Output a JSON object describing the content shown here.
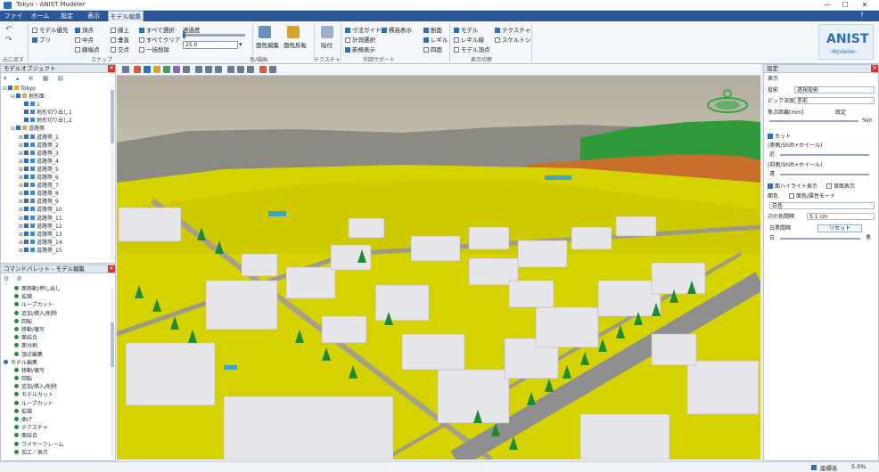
{
  "window": {
    "title": "Tokyo - ANIST Modeler",
    "controls": {
      "minimize": "—",
      "maximize": "☐",
      "close": "✕"
    },
    "help": "?"
  },
  "tabs": [
    {
      "label": "ファイル"
    },
    {
      "label": "ホーム"
    },
    {
      "label": "設定"
    },
    {
      "label": "表示"
    },
    {
      "label": "モデル編集",
      "active": true
    }
  ],
  "ribbon": {
    "undo_group": {
      "label": "元に戻す"
    },
    "snap_group": {
      "label": "スナップ",
      "items": [
        {
          "label": "モデル優先",
          "checked": false
        },
        {
          "label": "ブリ",
          "checked": true
        },
        {
          "label": "頂点",
          "checked": true
        },
        {
          "label": "中点",
          "checked": false
        },
        {
          "label": "線端点",
          "checked": false
        },
        {
          "label": "線上",
          "checked": false
        },
        {
          "label": "垂直",
          "checked": false
        },
        {
          "label": "交点",
          "checked": false
        }
      ]
    },
    "select_group": {
      "items": [
        {
          "label": "すべて選択",
          "checked": true
        },
        {
          "label": "すべてクリア",
          "checked": false
        },
        {
          "label": "一括削除",
          "checked": false
        }
      ]
    },
    "transparency": {
      "label": "透過度",
      "value": "25.0"
    },
    "color_group": {
      "label": "色/描画",
      "buttons": [
        {
          "label": "面色編集"
        },
        {
          "label": "面色反転"
        }
      ]
    },
    "texture_group": {
      "label": "テクスチャ",
      "button": "貼付"
    },
    "work_support_group": {
      "label": "作図サポート",
      "items": [
        {
          "label": "寸法ガイド",
          "checked": true
        },
        {
          "label": "標高表示",
          "checked": true
        },
        {
          "label": "計測選択",
          "checked": false
        },
        {
          "label": "断面",
          "checked": true
        },
        {
          "label": "新規表示",
          "checked": true
        },
        {
          "label": "レギル",
          "checked": true
        },
        {
          "label": "四面",
          "checked": false
        }
      ]
    },
    "display_group": {
      "label": "表示切替",
      "items": [
        {
          "label": "モデル",
          "checked": true
        },
        {
          "label": "テクスチャ",
          "checked": true
        },
        {
          "label": "レギル線",
          "checked": false
        },
        {
          "label": "スケルトン",
          "checked": false
        },
        {
          "label": "モデル頂点",
          "checked": false
        }
      ]
    },
    "logo": {
      "text": "ANIST",
      "subtext": "-Modeler-"
    }
  },
  "model_panel": {
    "title": "モデルオブジェクト",
    "tree": [
      {
        "indent": 0,
        "expander": "⊟",
        "kind": "folder",
        "label": "Tokyo"
      },
      {
        "indent": 1,
        "expander": "⊟",
        "kind": "folder",
        "label": "地形面"
      },
      {
        "indent": 2,
        "expander": "",
        "kind": "item",
        "label": "1"
      },
      {
        "indent": 2,
        "expander": "",
        "kind": "item",
        "label": "地形切り出し1"
      },
      {
        "indent": 2,
        "expander": "",
        "kind": "item",
        "label": "地形切り出し2"
      },
      {
        "indent": 1,
        "expander": "⊟",
        "kind": "folder",
        "label": "道路等"
      },
      {
        "indent": 2,
        "expander": "⊞",
        "kind": "item",
        "label": "道路等_1"
      },
      {
        "indent": 2,
        "expander": "⊞",
        "kind": "item",
        "label": "道路等_2"
      },
      {
        "indent": 2,
        "expander": "⊞",
        "kind": "item",
        "label": "道路等_3"
      },
      {
        "indent": 2,
        "expander": "⊞",
        "kind": "item",
        "label": "道路等_4"
      },
      {
        "indent": 2,
        "expander": "⊞",
        "kind": "item",
        "label": "道路等_5"
      },
      {
        "indent": 2,
        "expander": "⊞",
        "kind": "item",
        "label": "道路等_6"
      },
      {
        "indent": 2,
        "expander": "⊞",
        "kind": "item",
        "label": "道路等_7"
      },
      {
        "indent": 2,
        "expander": "⊞",
        "kind": "item",
        "label": "道路等_8"
      },
      {
        "indent": 2,
        "expander": "⊞",
        "kind": "item",
        "label": "道路等_9"
      },
      {
        "indent": 2,
        "expander": "⊞",
        "kind": "item",
        "label": "道路等_10"
      },
      {
        "indent": 2,
        "expander": "⊞",
        "kind": "item",
        "label": "道路等_11"
      },
      {
        "indent": 2,
        "expander": "⊞",
        "kind": "item",
        "label": "道路等_12"
      },
      {
        "indent": 2,
        "expander": "⊞",
        "kind": "item",
        "label": "道路等_13"
      },
      {
        "indent": 2,
        "expander": "⊞",
        "kind": "item",
        "label": "道路等_14"
      },
      {
        "indent": 2,
        "expander": "⊞",
        "kind": "item",
        "label": "道路等_15"
      }
    ]
  },
  "command_panel": {
    "title": "コマンドパレット - モデル編集",
    "items": [
      {
        "indent": 1,
        "label": "面移動/押し出し",
        "color": "green"
      },
      {
        "indent": 1,
        "label": "拡縮",
        "color": "green"
      },
      {
        "indent": 1,
        "label": "ループカット",
        "color": "green"
      },
      {
        "indent": 1,
        "label": "追加/挿入/削除",
        "color": "green"
      },
      {
        "indent": 1,
        "label": "回転",
        "color": "green"
      },
      {
        "indent": 1,
        "label": "移動/複写",
        "color": "green"
      },
      {
        "indent": 1,
        "label": "面結合",
        "color": "green"
      },
      {
        "indent": 1,
        "label": "面分割",
        "color": "green"
      },
      {
        "indent": 1,
        "label": "頂点編集",
        "color": "green"
      },
      {
        "indent": 0,
        "label": "モデル編集",
        "color": "blue"
      },
      {
        "indent": 1,
        "label": "移動/複写",
        "color": "green"
      },
      {
        "indent": 1,
        "label": "回転",
        "color": "green"
      },
      {
        "indent": 1,
        "label": "追加/挿入/削除",
        "color": "green"
      },
      {
        "indent": 1,
        "label": "モデルカット",
        "color": "green"
      },
      {
        "indent": 1,
        "label": "ループカット",
        "color": "green"
      },
      {
        "indent": 1,
        "label": "拡縮",
        "color": "green"
      },
      {
        "indent": 1,
        "label": "曲げ",
        "color": "green"
      },
      {
        "indent": 1,
        "label": "テクスチャ",
        "color": "green"
      },
      {
        "indent": 1,
        "label": "面結合",
        "color": "green"
      },
      {
        "indent": 1,
        "label": "ワイヤーフレーム",
        "color": "green"
      },
      {
        "indent": 1,
        "label": "加工／表示",
        "color": "green"
      }
    ]
  },
  "properties_panel": {
    "title": "設定",
    "section": "表示",
    "projection": {
      "label": "投影",
      "value": "透視投影"
    },
    "pick_depth": {
      "label": "ピック深度",
      "value": "手前"
    },
    "focal": {
      "label": "焦点距離[mm]",
      "value": "既定"
    },
    "unit": "%m",
    "cut_label": "カット",
    "depth1": {
      "label": "(奥側/Shift+ホイール)",
      "value": "近"
    },
    "depth2": {
      "label": "(前側/Shift+ホイール)",
      "value": "遠"
    },
    "hilite": {
      "label": "面ハイライト表示",
      "checked": true
    },
    "backface": {
      "label": "背面表示",
      "checked": false
    },
    "color_label": "面色",
    "color_mode_label": "面色/属性モード",
    "color_value": "白色",
    "edge_interval": {
      "label": "辺の色間隔",
      "value": "5.1 cm"
    },
    "opacity": {
      "label": "白黒間隔",
      "reset": "リセット"
    },
    "scale": {
      "left": "白",
      "right": "黒"
    }
  },
  "status": {
    "text": "座標系",
    "zoom": "5.0%"
  }
}
